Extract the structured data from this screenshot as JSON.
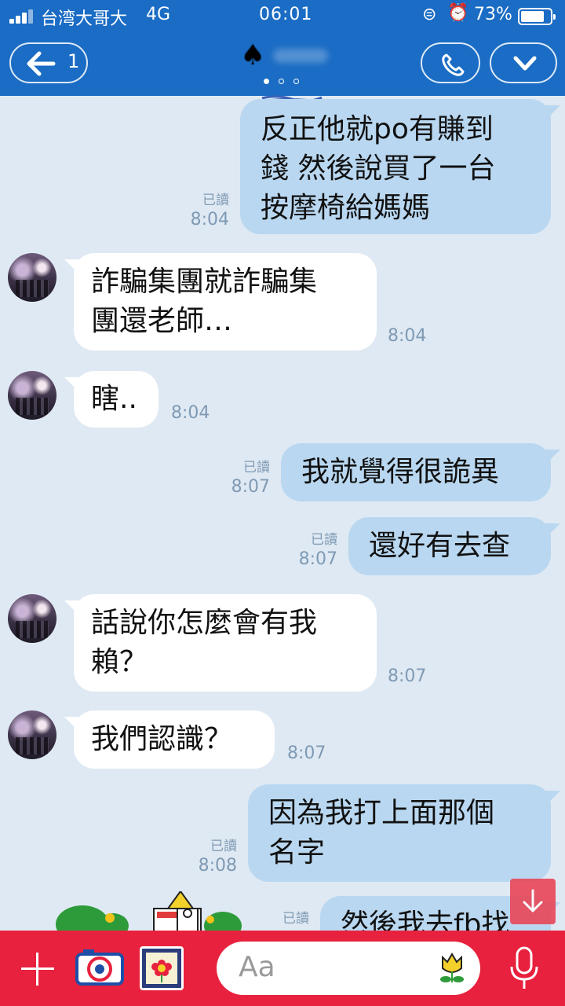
{
  "status_bar": {
    "carrier": "台湾大哥大",
    "network": "4G",
    "time": "06:01",
    "battery_text": "73%",
    "battery_level": 0.73
  },
  "header": {
    "unread_count": "1",
    "title_icon": "spade-icon"
  },
  "messages": [
    {
      "dir": "out",
      "lines": [
        "反正他就po有賺到",
        "錢 然後說買了一台",
        "按摩椅給媽媽"
      ],
      "read": "已讀",
      "time": "8:04"
    },
    {
      "dir": "in",
      "lines": [
        "詐騙集團就詐騙集",
        "團還老師…"
      ],
      "time": "8:04"
    },
    {
      "dir": "in",
      "lines": [
        "瞎.."
      ],
      "time": "8:04"
    },
    {
      "dir": "out",
      "lines": [
        "我就覺得很詭異"
      ],
      "read": "已讀",
      "time": "8:07"
    },
    {
      "dir": "out",
      "lines": [
        "還好有去查"
      ],
      "read": "已讀",
      "time": "8:07"
    },
    {
      "dir": "in",
      "lines": [
        "話說你怎麼會有我",
        "賴？"
      ],
      "time": "8:07"
    },
    {
      "dir": "in",
      "lines": [
        "我們認識？"
      ],
      "time": "8:07"
    },
    {
      "dir": "out",
      "lines": [
        "因為我打上面那個",
        "名字"
      ],
      "read": "已讀",
      "time": "8:08"
    },
    {
      "dir": "out",
      "lines": [
        "然後我去fb找"
      ],
      "read": "已讀"
    }
  ],
  "composer": {
    "placeholder": "Aa"
  },
  "colors": {
    "header": "#1a6cc4",
    "bottom_bar": "#e8213e",
    "outgoing_bubble": "#b9d7f0",
    "incoming_bubble": "#ffffff",
    "background": "#dfe9f3"
  }
}
